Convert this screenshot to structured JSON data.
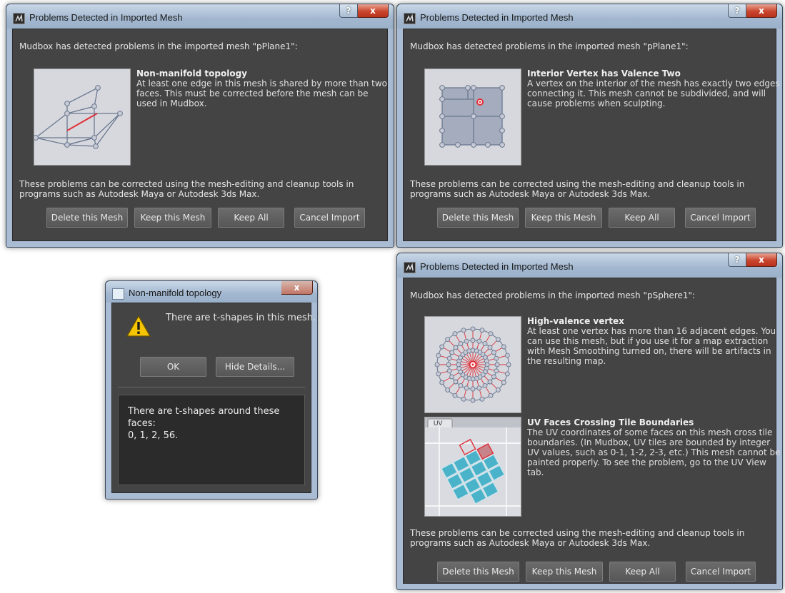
{
  "dialog_title": "Problems Detected in Imported Mesh",
  "footer_text": "These problems can be corrected using the mesh-editing and cleanup tools in programs such as Autodesk Maya or Autodesk 3ds Max.",
  "buttons": {
    "delete": "Delete this Mesh",
    "keep": "Keep this Mesh",
    "keep_all": "Keep All",
    "cancel": "Cancel Import"
  },
  "caption": {
    "help": "?",
    "close": "x"
  },
  "dialog1": {
    "intro": "Mudbox has detected problems in the imported mesh \"pPlane1\":",
    "problem": {
      "title": "Non-manifold topology",
      "description": "At least one edge in this mesh is shared by more than two faces. This must be corrected before the mesh can be used in Mudbox.",
      "icon": "non-manifold-edge-illustration"
    }
  },
  "dialog2": {
    "intro": "Mudbox has detected problems in the imported mesh \"pPlane1\":",
    "problem": {
      "title": "Interior Vertex has Valence Two",
      "description": "A vertex on the interior of the mesh has exactly two edges connecting it. This mesh cannot be subdivided, and will cause problems when sculpting.",
      "icon": "valence-two-vertex-illustration"
    }
  },
  "dialog3": {
    "intro": "Mudbox has detected problems in the imported mesh \"pSphere1\":",
    "problems": [
      {
        "title": "High-valence vertex",
        "description": "At least one vertex has more than 16 adjacent edges. You can use this mesh, but if you use it for a map extraction with Mesh Smoothing turned on, there will be artifacts in the resulting map.",
        "icon": "high-valence-vertex-illustration"
      },
      {
        "title": "UV Faces Crossing Tile Boundaries",
        "description": "The UV coordinates of some faces on this mesh cross tile boundaries. (In Mudbox, UV tiles are bounded by integer UV values, such as 0-1, 1-2, 2-3, etc.) This mesh cannot be painted properly. To see the problem, go to the UV View tab.",
        "icon": "uv-tile-crossing-illustration",
        "tab_label": "UV"
      }
    ]
  },
  "small_dialog": {
    "title": "Non-manifold topology",
    "message": "There are t-shapes in this mesh.",
    "ok": "OK",
    "hide_details": "Hide Details...",
    "details": "There are t-shapes around these faces:\n0, 1, 2, 56.",
    "icon": "warning-icon"
  },
  "colors": {
    "client_bg": "#444444",
    "button_bg": "#606060",
    "highlight": "#e0303a",
    "uv_face": "#4ab3c9"
  }
}
